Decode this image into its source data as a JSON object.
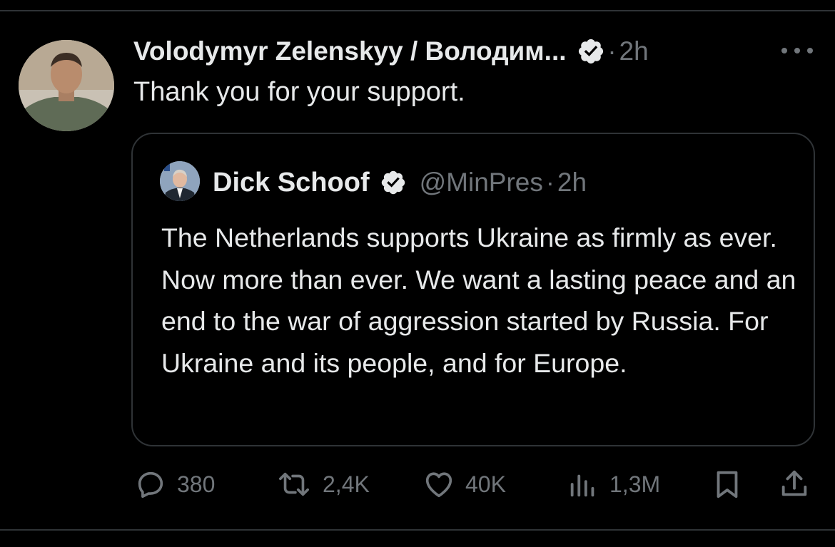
{
  "tweet": {
    "author_name": "Volodymyr Zelenskyy / Володим...",
    "separator": "·",
    "time": "2h",
    "text": "Thank you for your support.",
    "verified_icon": "verified-badge-icon",
    "colors": {
      "background": "#000000",
      "text": "#e7e9ea",
      "muted": "#71767b",
      "border": "#2f3336"
    }
  },
  "quote": {
    "name": "Dick Schoof",
    "handle": "@MinPres",
    "separator": "·",
    "time": "2h",
    "text": "The Netherlands supports Ukraine as firmly as ever. Now more than ever. We want a lasting peace and an end to the war of aggression started by Russia. For Ukraine and its people, and for Europe."
  },
  "actions": {
    "replies": "380",
    "reposts": "2,4K",
    "likes": "40K",
    "views": "1,3M",
    "icons": [
      "reply-icon",
      "repost-icon",
      "like-icon",
      "views-icon",
      "bookmark-icon",
      "share-icon"
    ]
  }
}
